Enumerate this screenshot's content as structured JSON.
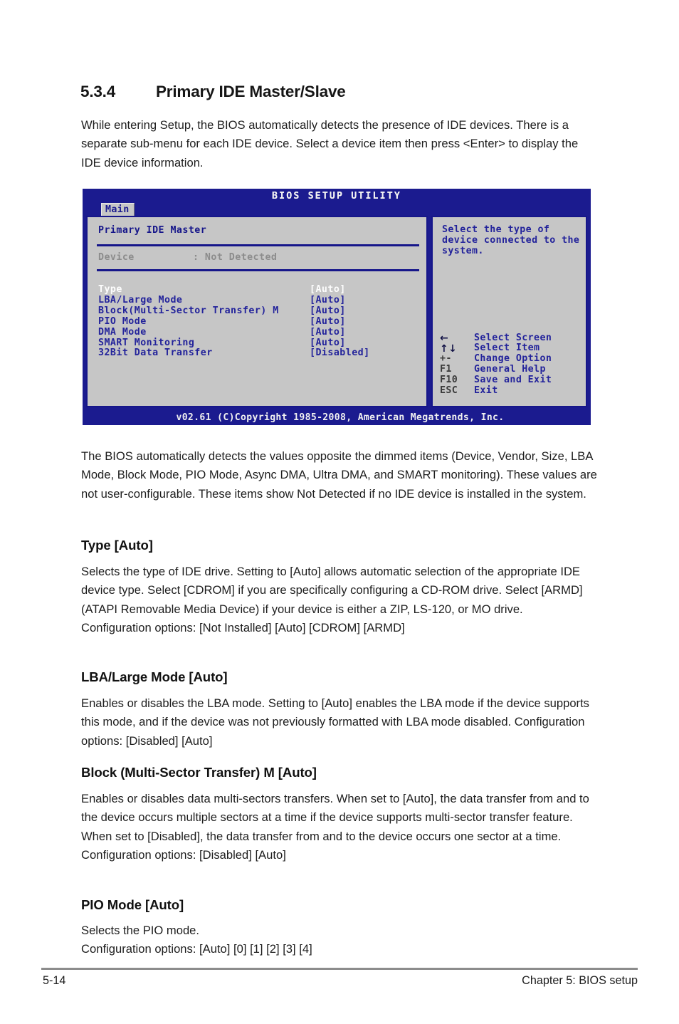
{
  "section": {
    "number": "5.3.4",
    "title": "Primary IDE Master/Slave"
  },
  "intro": "While entering Setup, the BIOS automatically detects the presence of IDE devices. There is a separate sub-menu for each IDE device. Select a device item then press <Enter> to display the IDE device information.",
  "bios": {
    "title": "BIOS SETUP UTILITY",
    "tab": "Main",
    "screen_heading": "Primary IDE Master",
    "device_label": "Device",
    "device_value": ": Not Detected",
    "options": [
      {
        "name": "Type",
        "value": "[Auto]",
        "selected": true
      },
      {
        "name": "LBA/Large Mode",
        "value": "[Auto]",
        "selected": false
      },
      {
        "name": "Block(Multi-Sector Transfer) M",
        "value": "[Auto]",
        "selected": false
      },
      {
        "name": "PIO Mode",
        "value": "[Auto]",
        "selected": false
      },
      {
        "name": "DMA Mode",
        "value": "[Auto]",
        "selected": false
      },
      {
        "name": "SMART Monitoring",
        "value": "[Auto]",
        "selected": false
      },
      {
        "name": "32Bit Data Transfer",
        "value": "[Disabled]",
        "selected": false
      }
    ],
    "help": "Select the type of\ndevice connected to the\nsystem.",
    "legend": [
      {
        "key": "←",
        "icon": "left-arrow-icon",
        "label": "Select Screen"
      },
      {
        "key": "↑↓",
        "icon": "up-down-arrow-icon",
        "label": "Select Item"
      },
      {
        "key": "+-",
        "icon": "plus-minus-key",
        "label": "Change Option"
      },
      {
        "key": "F1",
        "icon": "f1-key",
        "label": "General Help"
      },
      {
        "key": "F10",
        "icon": "f10-key",
        "label": "Save and Exit"
      },
      {
        "key": "ESC",
        "icon": "esc-key",
        "label": "Exit"
      }
    ],
    "footer": "v02.61 (C)Copyright 1985-2008, American Megatrends, Inc.",
    "colors": {
      "chrome_blue": "#1b1b8f",
      "pane_gray": "#c6c6c6",
      "text_blue": "#23239b",
      "dimmed_gray": "#8c8c8c",
      "selected_white": "#fdfdfd"
    }
  },
  "paragraphs": {
    "dimmed_items": "The BIOS automatically detects the values opposite the dimmed items (Device, Vendor, Size, LBA Mode, Block Mode, PIO Mode, Async DMA, Ultra DMA, and SMART monitoring). These values are not user-configurable. These items show Not Detected if no IDE device is installed in the system."
  },
  "items": {
    "type": {
      "heading": "Type [Auto]",
      "body": "Selects the type of IDE drive. Setting to [Auto] allows automatic selection of the appropriate IDE device type. Select [CDROM] if you are specifically configuring a CD-ROM drive. Select [ARMD] (ATAPI Removable Media Device) if your device is either a ZIP, LS-120, or MO drive.\nConfiguration options: [Not Installed] [Auto] [CDROM] [ARMD]"
    },
    "lba": {
      "heading": "LBA/Large Mode [Auto]",
      "body": "Enables or disables the LBA mode. Setting to [Auto] enables the LBA mode if the device supports this mode, and if the device was not previously formatted with LBA mode disabled. Configuration options: [Disabled] [Auto]"
    },
    "block": {
      "heading": "Block (Multi-Sector Transfer) M [Auto]",
      "body": "Enables or disables data multi-sectors transfers. When set to [Auto], the data transfer from and to the device occurs multiple sectors at a time if the device supports multi-sector transfer feature. When set to [Disabled], the data transfer from and to the device occurs one sector at a time.\nConfiguration options: [Disabled] [Auto]"
    },
    "pio": {
      "heading": "PIO Mode [Auto]",
      "body": "Selects the PIO mode.\nConfiguration options: [Auto] [0] [1] [2] [3] [4]"
    }
  },
  "footer": {
    "page": "5-14",
    "chapter": "Chapter 5: BIOS setup"
  }
}
